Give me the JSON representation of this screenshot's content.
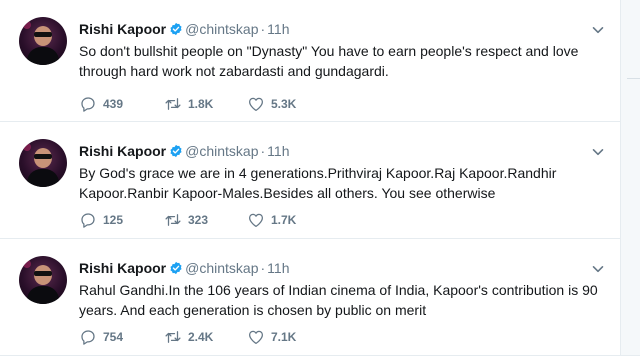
{
  "tweets": [
    {
      "name": "Rishi Kapoor",
      "handle": "@chintskap",
      "separator": "·",
      "time": "11h",
      "text": "So don't bullshit people on \"Dynasty\" You have to earn people's respect and love through hard work not zabardasti and gundagardi.",
      "replies": "439",
      "retweets": "1.8K",
      "likes": "5.3K"
    },
    {
      "name": "Rishi Kapoor",
      "handle": "@chintskap",
      "separator": "·",
      "time": "11h",
      "text": "By God's grace we are in 4 generations.Prithviraj Kapoor.Raj Kapoor.Randhir Kapoor.Ranbir Kapoor-Males.Besides all others. You see otherwise",
      "replies": "125",
      "retweets": "323",
      "likes": "1.7K"
    },
    {
      "name": "Rishi Kapoor",
      "handle": "@chintskap",
      "separator": "·",
      "time": "11h",
      "text": "Rahul Gandhi.In the 106 years of Indian cinema of India, Kapoor's contribution is 90 years. And each generation is chosen by public on merit",
      "replies": "754",
      "retweets": "2.4K",
      "likes": "7.1K"
    }
  ],
  "icons": {
    "verified": "verified-badge-icon",
    "reply": "reply-icon",
    "retweet": "retweet-icon",
    "like": "heart-icon",
    "dm": "envelope-icon",
    "caret": "chevron-down-icon"
  },
  "colors": {
    "verified": "#1da1f2",
    "muted": "#657786",
    "text": "#14171a"
  }
}
